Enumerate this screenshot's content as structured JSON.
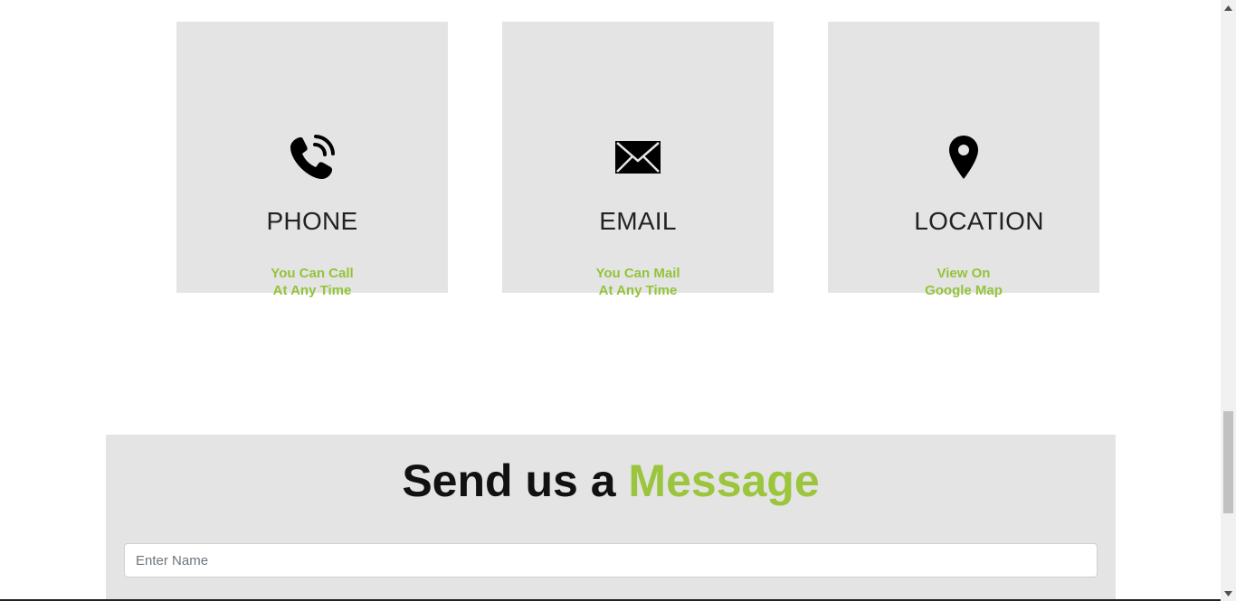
{
  "contact_cards": [
    {
      "title": "PHONE",
      "line1": "You Can Call",
      "line2": "At Any Time",
      "icon": "phone-icon"
    },
    {
      "title": "EMAIL",
      "line1": "You Can Mail",
      "line2": "At Any Time",
      "icon": "envelope-icon"
    },
    {
      "title": "LOCATION",
      "line1": "View On",
      "line2": "Google Map",
      "icon": "map-pin-icon"
    }
  ],
  "message_section": {
    "heading_main": "Send us a",
    "heading_accent": "Message",
    "name_placeholder": "Enter Name"
  },
  "colors": {
    "accent": "#9bc53d",
    "card_bg": "#e4e4e4",
    "text_dark": "#222222"
  }
}
